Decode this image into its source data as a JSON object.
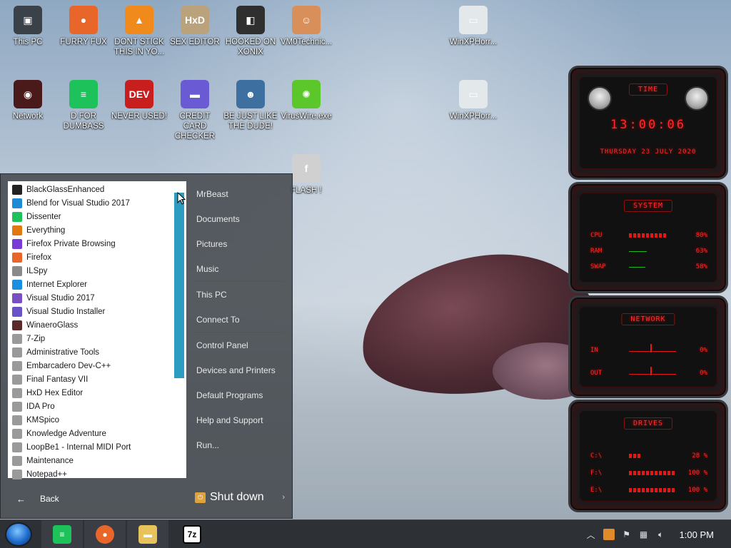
{
  "desktop": {
    "icons": [
      {
        "label": "This PC",
        "glyph": "▣",
        "color": "#3a4148"
      },
      {
        "label": "FURRY FUX",
        "glyph": "●",
        "color": "#e8662a"
      },
      {
        "label": "DONT STICK THIS IN YO...",
        "glyph": "▲",
        "color": "#f08a1d"
      },
      {
        "label": "SEX EDITOR",
        "glyph": "HxD",
        "color": "#b9a27c"
      },
      {
        "label": "HOOKED ON XONIX",
        "glyph": "◧",
        "color": "#2f2f2f"
      },
      {
        "label": "VM0Technic...",
        "glyph": "☺",
        "color": "#d98f5a"
      },
      {
        "label": "WinXPHorr...",
        "glyph": "▭",
        "color": "#e3e8ea"
      },
      {
        "label": "Network",
        "glyph": "◉",
        "color": "#4a1a1a"
      },
      {
        "label": "D FOR DUMBASS",
        "glyph": "≡",
        "color": "#1ec25a"
      },
      {
        "label": "NEVER USED!",
        "glyph": "DEV",
        "color": "#c81e1e"
      },
      {
        "label": "CREDIT CARD CHECKER",
        "glyph": "▬",
        "color": "#6a5ad4"
      },
      {
        "label": "BE JUST LIKE THE DUDE!",
        "glyph": "☻",
        "color": "#3d6fa0"
      },
      {
        "label": "VirusWire.exe",
        "glyph": "✺",
        "color": "#5cc72a"
      },
      {
        "label": "WinXPHorr...",
        "glyph": "▭",
        "color": "#e3e8ea"
      },
      {
        "label": "FLASH !",
        "glyph": "f",
        "color": "#d0d0d0"
      }
    ]
  },
  "start_menu": {
    "programs": [
      {
        "label": "BlackGlassEnhanced",
        "color": "#222"
      },
      {
        "label": "Blend for Visual Studio 2017",
        "color": "#1f8ad6"
      },
      {
        "label": "Dissenter",
        "color": "#1ec25a"
      },
      {
        "label": "Everything",
        "color": "#e07a10"
      },
      {
        "label": "Firefox Private Browsing",
        "color": "#7a3ad6"
      },
      {
        "label": "Firefox",
        "color": "#e8662a"
      },
      {
        "label": "ILSpy",
        "color": "#8a8a8a"
      },
      {
        "label": "Internet Explorer",
        "color": "#1a8ee0"
      },
      {
        "label": "Visual Studio 2017",
        "color": "#7b4fc4"
      },
      {
        "label": "Visual Studio Installer",
        "color": "#6a52c9"
      },
      {
        "label": "WinaeroGlass",
        "color": "#5a2a2a"
      },
      {
        "label": "7-Zip",
        "color": "#9a9a9a"
      },
      {
        "label": "Administrative Tools",
        "color": "#9a9a9a"
      },
      {
        "label": "Embarcadero Dev-C++",
        "color": "#9a9a9a"
      },
      {
        "label": "Final Fantasy VII",
        "color": "#9a9a9a"
      },
      {
        "label": "HxD Hex Editor",
        "color": "#9a9a9a"
      },
      {
        "label": "IDA Pro",
        "color": "#9a9a9a"
      },
      {
        "label": "KMSpico",
        "color": "#9a9a9a"
      },
      {
        "label": "Knowledge Adventure",
        "color": "#9a9a9a"
      },
      {
        "label": "LoopBe1 - Internal MIDI Port",
        "color": "#9a9a9a"
      },
      {
        "label": "Maintenance",
        "color": "#9a9a9a"
      },
      {
        "label": "Notepad++",
        "color": "#9a9a9a"
      }
    ],
    "back_label": "Back",
    "right_items": [
      {
        "label": "MrBeast"
      },
      {
        "label": "Documents"
      },
      {
        "label": "Pictures"
      },
      {
        "label": "Music"
      },
      {
        "label": "This PC"
      },
      {
        "label": "Connect To"
      },
      {
        "label": "Control Panel"
      },
      {
        "label": "Devices and Printers"
      },
      {
        "label": "Default Programs"
      },
      {
        "label": "Help and Support"
      },
      {
        "label": "Run..."
      }
    ],
    "shutdown_label": "Shut down"
  },
  "gadgets": {
    "time": {
      "title": "TIME",
      "clock": "13:00:06",
      "date": "THURSDAY 23 JULY 2020"
    },
    "system": {
      "title": "SYSTEM",
      "rows": [
        {
          "label": "CPU",
          "value": "80%",
          "level": 0.8
        },
        {
          "label": "RAM",
          "value": "63%",
          "level": 0.63
        },
        {
          "label": "SWAP",
          "value": "58%",
          "level": 0.58
        }
      ]
    },
    "network": {
      "title": "NETWORK",
      "rows": [
        {
          "label": "IN",
          "value": "0%"
        },
        {
          "label": "OUT",
          "value": "0%"
        }
      ]
    },
    "drives": {
      "title": "DRIVES",
      "rows": [
        {
          "label": "C:\\",
          "value": "28 %",
          "level": 0.28
        },
        {
          "label": "F:\\",
          "value": "100 %",
          "level": 1.0
        },
        {
          "label": "E:\\",
          "value": "100 %",
          "level": 1.0
        }
      ]
    }
  },
  "taskbar": {
    "clock": "1:00 PM"
  },
  "colors": {
    "accent": "#2e9bc0",
    "gadget_red": "#ff2a2a"
  }
}
